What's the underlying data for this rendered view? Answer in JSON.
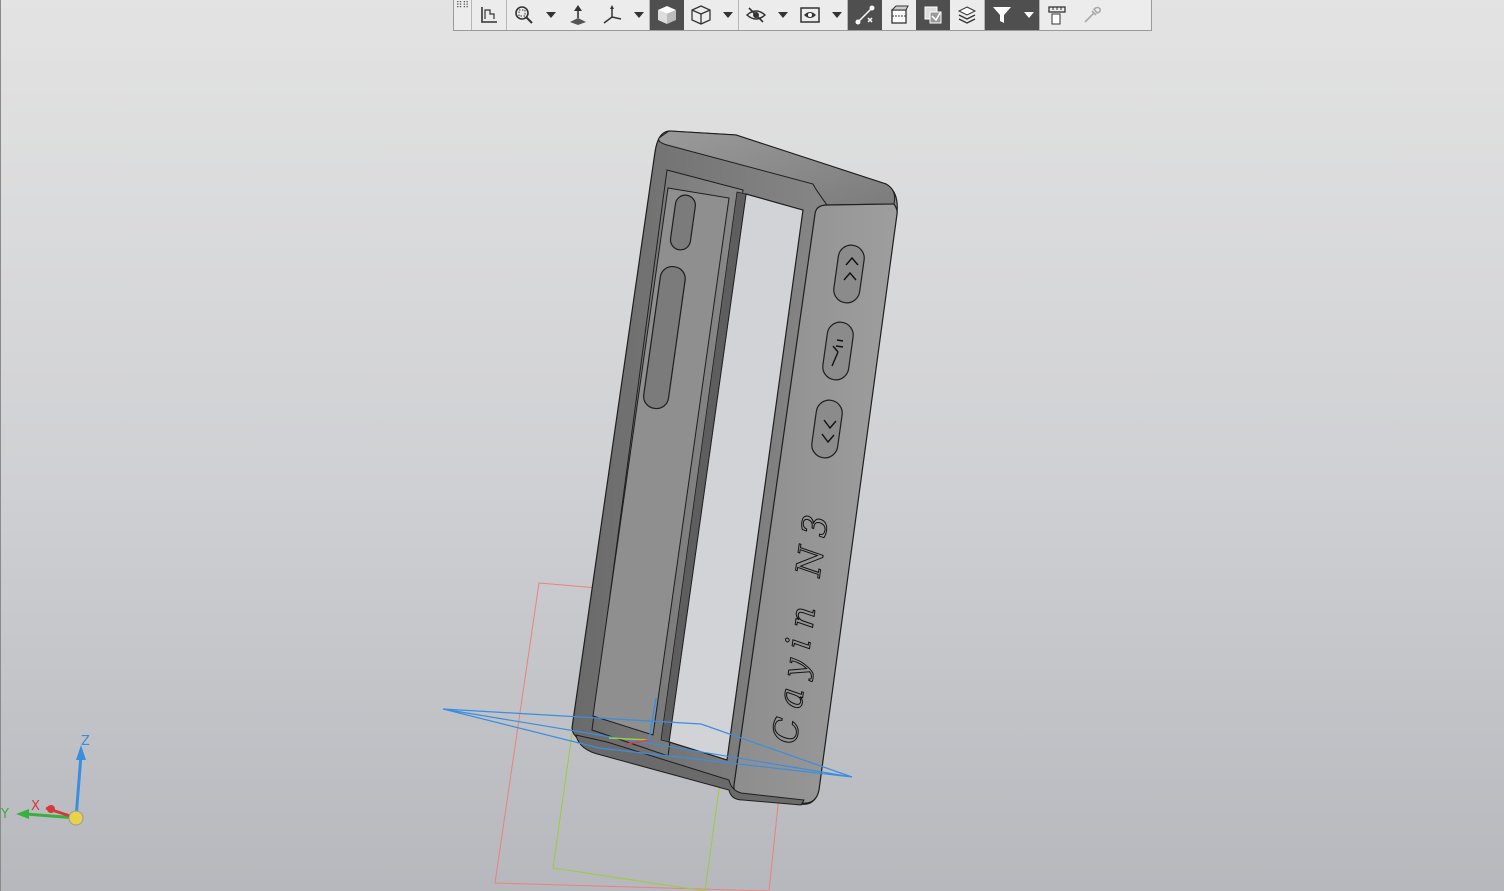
{
  "toolbar": {
    "buttons": [
      {
        "name": "sketch",
        "icon": "sketch-icon"
      },
      {
        "name": "zoom",
        "icon": "zoom-icon",
        "dropdown": true
      },
      {
        "name": "orientation",
        "icon": "view-orientation-icon"
      },
      {
        "name": "triad-view",
        "icon": "triad-view-icon",
        "dropdown": true
      },
      {
        "name": "shaded",
        "icon": "shaded-cube-icon",
        "active": true
      },
      {
        "name": "wireframe",
        "icon": "wireframe-cube-icon",
        "dropdown": true
      },
      {
        "name": "hide-show",
        "icon": "hide-show-icon",
        "dropdown": true
      },
      {
        "name": "display-mode",
        "icon": "display-mode-icon",
        "dropdown": true
      },
      {
        "name": "snap",
        "icon": "snap-icon",
        "active": true
      },
      {
        "name": "section",
        "icon": "section-view-icon"
      },
      {
        "name": "layers",
        "icon": "layers-icon",
        "active": true
      },
      {
        "name": "stack",
        "icon": "stack-icon"
      },
      {
        "name": "filter",
        "icon": "filter-icon",
        "active": true,
        "dropdown": true
      },
      {
        "name": "measure",
        "icon": "measure-icon"
      },
      {
        "name": "pick",
        "icon": "eyedropper-icon",
        "disabled": true
      }
    ]
  },
  "model": {
    "engraving_text": "Cayin N3",
    "buttons": [
      "<<",
      ">||",
      ">>"
    ]
  },
  "triad": {
    "x_label": "X",
    "y_label": "Y",
    "z_label": "Z"
  },
  "colors": {
    "plane_front": "#e8837e",
    "plane_right": "#9ccc3a",
    "plane_top": "#3a8ee0",
    "model_body": "#8a8a8a"
  }
}
